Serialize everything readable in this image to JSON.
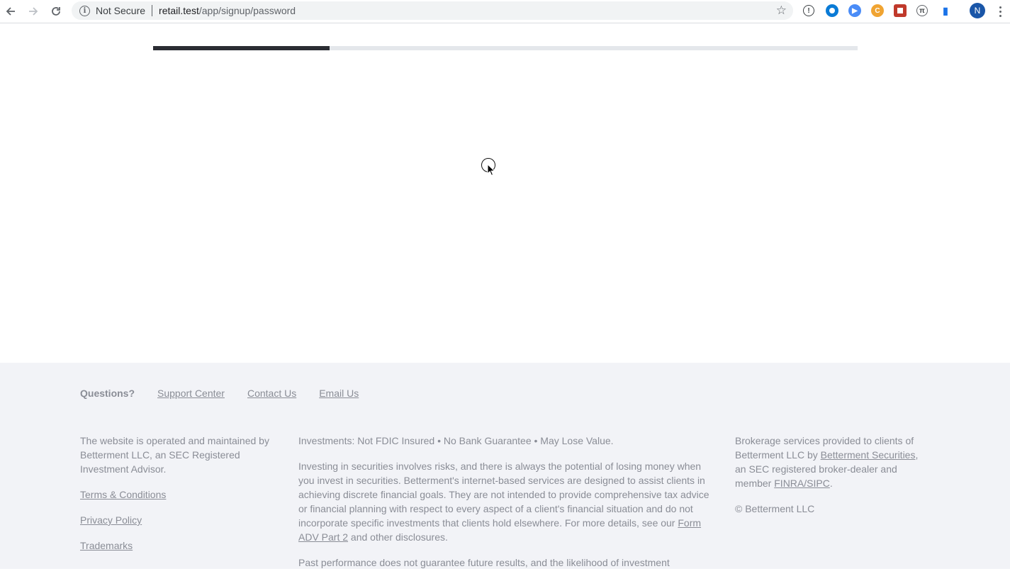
{
  "browser": {
    "security_label": "Not Secure",
    "url_host": "retail.test",
    "url_path": "/app/signup/password",
    "profile_initial": "N"
  },
  "signup": {
    "progress_fraction": 0.25
  },
  "footer": {
    "questions_label": "Questions?",
    "links": {
      "support": "Support Center",
      "contact": "Contact Us",
      "email": "Email Us"
    },
    "col1": {
      "operated_by": "The website is operated and maintained by Betterment LLC, an SEC Registered Investment Advisor.",
      "terms": "Terms & Conditions",
      "privacy": "Privacy Policy",
      "trademarks": "Trademarks"
    },
    "col2": {
      "insured": "Investments: Not FDIC Insured • No Bank Guarantee • May Lose Value.",
      "risk_text": "Investing in securities involves risks, and there is always the potential of losing money when you invest in securities. Betterment's internet-based services are designed to assist clients in achieving discrete financial goals. They are not intended to provide comprehensive tax advice or financial planning with respect to every aspect of a client's financial situation and do not incorporate specific investments that clients hold elsewhere. For more details, see our",
      "form_adv_link": "Form ADV Part 2",
      "risk_text_end": "and other disclosures.",
      "past_performance": "Past performance does not guarantee future results, and the likelihood of investment"
    },
    "col3": {
      "brokerage_text": "Brokerage services provided to clients of Betterment LLC by",
      "securities_link": "Betterment Securities",
      "brokerage_mid": ", an SEC registered broker-dealer and member",
      "finra_link": "FINRA/SIPC",
      "brokerage_end": ".",
      "copyright": "© Betterment LLC"
    }
  },
  "colors": {
    "progress_fill": "#2b2d33",
    "progress_track": "#e4e7eb",
    "footer_bg": "#f2f3f7",
    "footer_text": "#8a8d96"
  }
}
